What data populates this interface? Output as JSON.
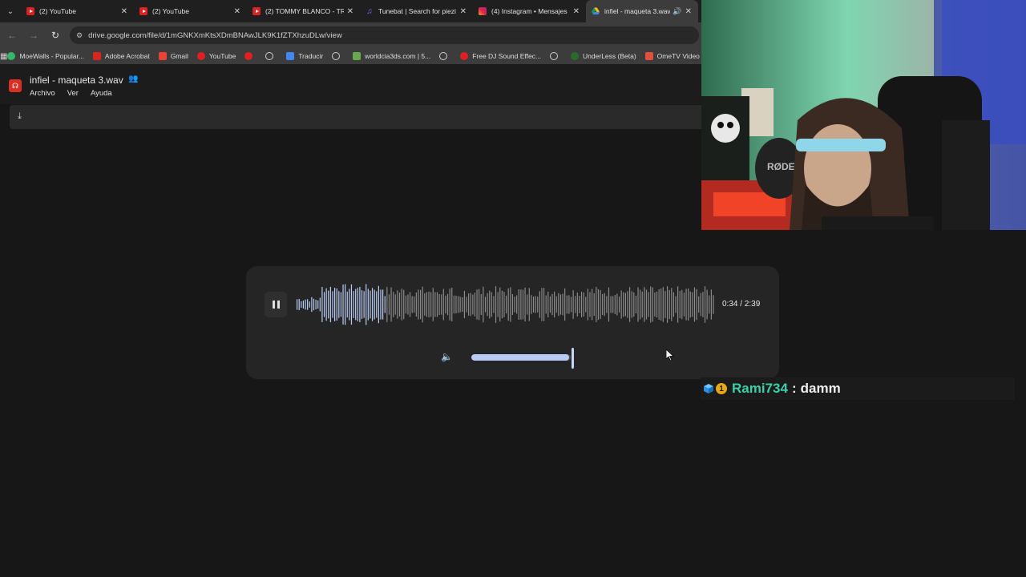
{
  "browser": {
    "tabs": [
      {
        "label": "(2) YouTube",
        "icon": "youtube-icon",
        "active": false
      },
      {
        "label": "(2) YouTube",
        "icon": "youtube-icon",
        "active": false
      },
      {
        "label": "(2) TOMMY BLANCO - TR",
        "icon": "youtube-icon",
        "active": false
      },
      {
        "label": "Tunebat | Search for piezi",
        "icon": "tunebat-icon",
        "active": false
      },
      {
        "label": "(4) Instagram • Mensajes",
        "icon": "instagram-icon",
        "active": false
      },
      {
        "label": "infiel - maqueta 3.wav",
        "icon": "google-drive-icon",
        "active": true
      }
    ],
    "url": "drive.google.com/file/d/1mGNKXmKtsXDmBNAwJLK9K1fZTXhzuDLw/view",
    "bookmarks": [
      {
        "label": "MoeWalls - Popular...",
        "icon": "moewalls-icon"
      },
      {
        "label": "Adobe Acrobat",
        "icon": "acrobat-icon"
      },
      {
        "label": "Gmail",
        "icon": "gmail-icon"
      },
      {
        "label": "YouTube",
        "icon": "youtube-icon"
      },
      {
        "label": "",
        "icon": "youtube-icon"
      },
      {
        "label": "",
        "icon": "globe-icon"
      },
      {
        "label": "Traducir",
        "icon": "translate-icon"
      },
      {
        "label": "",
        "icon": "globe-icon"
      },
      {
        "label": "worldcia3ds.com | 5...",
        "icon": "worldcia-icon"
      },
      {
        "label": "",
        "icon": "globe-icon"
      },
      {
        "label": "Free DJ Sound Effec...",
        "icon": "youtube-icon"
      },
      {
        "label": "",
        "icon": "globe-icon"
      },
      {
        "label": "UnderLess (Beta)",
        "icon": "underless-icon"
      },
      {
        "label": "OmeTV Video Chat...",
        "icon": "ometv-icon"
      }
    ]
  },
  "viewer": {
    "title": "infiel - maqueta 3.wav",
    "menu": [
      "Archivo",
      "Ver",
      "Ayuda"
    ]
  },
  "player": {
    "time": "0:34 / 2:39",
    "progress": 0.214,
    "volume": 0.98,
    "state": "playing"
  },
  "chat": {
    "user": "Rami734",
    "separator": ":",
    "message": "damm",
    "user_color": "#3ccfa8"
  },
  "colors": {
    "accent": "#b9ccf5",
    "page_bg": "#171717",
    "youtube_red": "#e02020",
    "drive_red": "#d93025"
  }
}
